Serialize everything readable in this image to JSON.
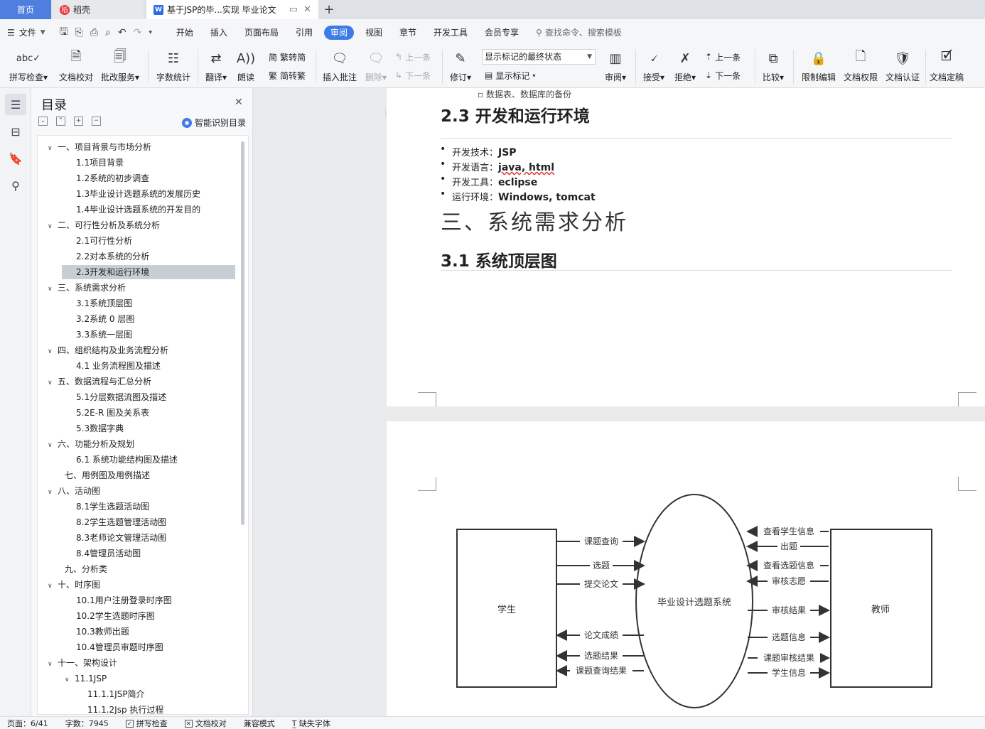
{
  "tabs": {
    "home": "首页",
    "daoke": "稻壳",
    "doc": "基于JSP的毕...实现 毕业论文",
    "add": "+"
  },
  "menu": {
    "file": "文件",
    "items": [
      "开始",
      "插入",
      "页面布局",
      "引用",
      "审阅",
      "视图",
      "章节",
      "开发工具",
      "会员专享"
    ],
    "active": "审阅",
    "search": "查找命令、搜索模板"
  },
  "ribbon": {
    "spell_check": "拼写检查",
    "doc_check": "文档校对",
    "revise_service": "批改服务",
    "word_count": "字数统计",
    "translate": "翻译",
    "read_aloud": "朗读",
    "trad_to_simp": "繁转简",
    "simp_to_trad": "简转繁",
    "insert_comment": "插入批注",
    "delete": "删除",
    "prev": "上一条",
    "next": "下一条",
    "track_changes": "修订",
    "markup_state": "显示标记的最终状态",
    "show_markup": "显示标记",
    "review": "审阅",
    "accept": "接受",
    "reject": "拒绝",
    "prev2": "上一条",
    "next2": "下一条",
    "compare": "比较",
    "restrict_edit": "限制编辑",
    "doc_permission": "文档权限",
    "doc_cert": "文档认证",
    "doc_final": "文档定稿"
  },
  "toc": {
    "title": "目录",
    "smart": "智能识别目录",
    "items": [
      {
        "text": "一、项目背景与市场分析",
        "level": 1,
        "chev": true
      },
      {
        "text": "1.1项目背景",
        "level": 2
      },
      {
        "text": "1.2系统的初步调查",
        "level": 2
      },
      {
        "text": "1.3毕业设计选题系统的发展历史",
        "level": 2
      },
      {
        "text": "1.4毕业设计选题系统的开发目的",
        "level": 2
      },
      {
        "text": "二、可行性分析及系统分析",
        "level": 1,
        "chev": true
      },
      {
        "text": "2.1可行性分析",
        "level": 2
      },
      {
        "text": "2.2对本系统的分析",
        "level": 2
      },
      {
        "text": "2.3开发和运行环境",
        "level": 2,
        "selected": true
      },
      {
        "text": "三、系统需求分析",
        "level": 1,
        "chev": true
      },
      {
        "text": "3.1系统顶层图",
        "level": 2
      },
      {
        "text": "3.2系统 0 层图",
        "level": 2
      },
      {
        "text": "3.3系统一层图",
        "level": 2
      },
      {
        "text": "四、组织结构及业务流程分析",
        "level": 1,
        "chev": true
      },
      {
        "text": "4.1 业务流程图及描述",
        "level": 2
      },
      {
        "text": "五、数据流程与汇总分析",
        "level": 1,
        "chev": true
      },
      {
        "text": "5.1分层数据流图及描述",
        "level": 2
      },
      {
        "text": "5.2E-R 图及关系表",
        "level": 2
      },
      {
        "text": "5.3数据字典",
        "level": 2
      },
      {
        "text": "六、功能分析及规划",
        "level": 1,
        "chev": true
      },
      {
        "text": "6.1 系统功能结构图及描述",
        "level": 2
      },
      {
        "text": "七、用例图及用例描述",
        "level": 1
      },
      {
        "text": "八、活动图",
        "level": 1,
        "chev": true
      },
      {
        "text": "8.1学生选题活动图",
        "level": 2
      },
      {
        "text": "8.2学生选题管理活动图",
        "level": 2
      },
      {
        "text": "8.3老师论文管理活动图",
        "level": 2
      },
      {
        "text": "8.4管理员活动图",
        "level": 2
      },
      {
        "text": "九、分析类",
        "level": 1
      },
      {
        "text": "十、时序图",
        "level": 1,
        "chev": true
      },
      {
        "text": "10.1用户注册登录时序图",
        "level": 2
      },
      {
        "text": "10.2学生选题时序图",
        "level": 2
      },
      {
        "text": "10.3教师出题",
        "level": 2
      },
      {
        "text": "10.4管理员审题时序图",
        "level": 2
      },
      {
        "text": "十一、架构设计",
        "level": 1,
        "chev": true
      },
      {
        "text": "11.1JSP",
        "level": 2,
        "chev": true
      },
      {
        "text": "11.1.1JSP简介",
        "level": 3
      },
      {
        "text": "11.1.2Jsp 执行过程",
        "level": 3
      }
    ]
  },
  "doc": {
    "cut_line": "数据表、数据库的备份",
    "h2_env": "2.3 开发和运行环境",
    "bullets": [
      {
        "label": "开发技术：",
        "value": "JSP"
      },
      {
        "label": "开发语言：",
        "value": "java, html"
      },
      {
        "label": "开发工具：",
        "value": "eclipse"
      },
      {
        "label": "运行环境：",
        "value": "Windows, tomcat"
      }
    ],
    "h1_req": "三、系统需求分析",
    "h2_top": "3.1 系统顶层图"
  },
  "diagram": {
    "student": "学生",
    "system": "毕业设计选题系统",
    "teacher": "教师",
    "left_flows": [
      {
        "text": "课题查询",
        "dir": "in"
      },
      {
        "text": "选题",
        "dir": "in"
      },
      {
        "text": "提交论文",
        "dir": "in"
      },
      {
        "text": "论文成绩",
        "dir": "out"
      },
      {
        "text": "选题结果",
        "dir": "out"
      },
      {
        "text": "课题查询结果",
        "dir": "out"
      }
    ],
    "right_flows": [
      {
        "text": "查看学生信息",
        "dir": "in"
      },
      {
        "text": "出题",
        "dir": "in"
      },
      {
        "text": "查看选题信息",
        "dir": "in"
      },
      {
        "text": "审核志愿",
        "dir": "in"
      },
      {
        "text": "审核结果",
        "dir": "out"
      },
      {
        "text": "选题信息",
        "dir": "out"
      },
      {
        "text": "课题审核结果",
        "dir": "out"
      },
      {
        "text": "学生信息",
        "dir": "out"
      }
    ]
  },
  "status": {
    "page": "页面：6/41",
    "words": "字数：7945",
    "spell": "拼写检查",
    "proof": "文档校对",
    "compat": "兼容模式",
    "missing_font": "缺失字体"
  }
}
